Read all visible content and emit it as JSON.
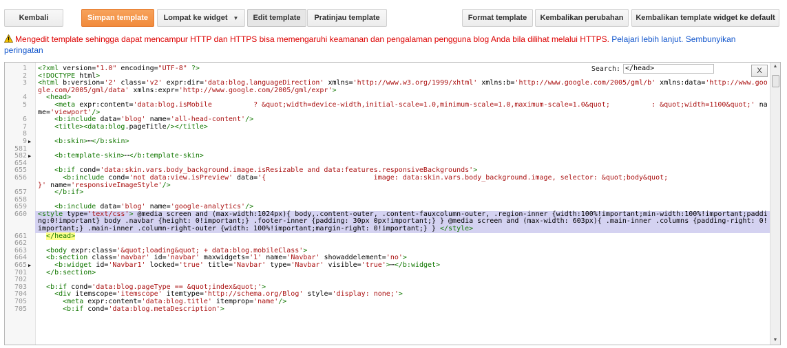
{
  "toolbar": {
    "back": "Kembali",
    "save": "Simpan template",
    "jump": "Lompat ke widget",
    "edit": "Edit template",
    "preview": "Pratinjau template",
    "format": "Format template",
    "revert": "Kembalikan perubahan",
    "revert_widgets": "Kembalikan template widget ke default"
  },
  "warning": {
    "text": "Mengedit template sehingga dapat mencampur HTTP dan HTTPS bisa memengaruhi keamanan dan pengalaman pengguna blog Anda bila dilihat melalui HTTPS. ",
    "learn_more": "Pelajari lebih lanjut.",
    "hide": "Sembunyikan peringatan"
  },
  "search": {
    "label": "Search:",
    "value": "</head>",
    "close": "X"
  },
  "colors": {
    "accent": "#f18b3c",
    "highlight": "#d4d2f1",
    "warning": "#dd0000",
    "link": "#1155cc"
  },
  "code_lines": [
    {
      "n": "1",
      "t": "<?xml version=\"1.0\" encoding=\"UTF-8\" ?>"
    },
    {
      "n": "2",
      "t": "<!DOCTYPE html>"
    },
    {
      "n": "3",
      "t": "<html b:version='2' class='v2' expr:dir='data:blog.languageDirection' xmlns='http://www.w3.org/1999/xhtml' xmlns:b='http://www.google.com/2005/gml/b' xmlns:data='http://www.google.com/2005/gml/data' xmlns:expr='http://www.google.com/2005/gml/expr'>"
    },
    {
      "n": "4",
      "t": "  <head>"
    },
    {
      "n": "5",
      "t": "    <meta expr:content='data:blog.isMobile          ? &quot;width=device-width,initial-scale=1.0,minimum-scale=1.0,maximum-scale=1.0&quot;          : &quot;width=1100&quot;' name='viewport'/>"
    },
    {
      "n": "6",
      "t": "    <b:include data='blog' name='all-head-content'/>"
    },
    {
      "n": "7",
      "t": "    <title><data:blog.pageTitle/></title>"
    },
    {
      "n": "8",
      "t": ""
    },
    {
      "n": "9",
      "f": "▶",
      "t": "    <b:skin>⋯</b:skin>"
    },
    {
      "n": "581",
      "t": ""
    },
    {
      "n": "582",
      "f": "▶",
      "t": "    <b:template-skin>⋯</b:template-skin>"
    },
    {
      "n": "654",
      "t": ""
    },
    {
      "n": "655",
      "t": "    <b:if cond='data:skin.vars.body_background.image.isResizable and data:features.responsiveBackgrounds'>"
    },
    {
      "n": "656",
      "t": "      <b:include cond='not data:view.isPreview' data='{                          image: data:skin.vars.body_background.image, selector: &quot;body&quot;                          }' name='responsiveImageStyle'/>"
    },
    {
      "n": "657",
      "t": "    </b:if>"
    },
    {
      "n": "658",
      "t": ""
    },
    {
      "n": "659",
      "t": "    <b:include data='blog' name='google-analytics'/>"
    },
    {
      "n": "660",
      "hl": true,
      "t": "<style type='text/css'> @media screen and (max-width:1024px){ body,.content-outer, .content-fauxcolumn-outer, .region-inner {width:100%!important;min-width:100%!important;padding:0!important} body .navbar {height: 0!important;} .footer-inner {padding: 30px 0px!important;} } @media screen and (max-width: 603px){ .main-inner .columns {padding-right: 0!important;} .main-inner .column-right-outer {width: 100%!important;margin-right: 0!important;} } </style>"
    },
    {
      "n": "661",
      "hl2": true,
      "t": "  </head>"
    },
    {
      "n": "662",
      "t": ""
    },
    {
      "n": "663",
      "t": "  <body expr:class='&quot;loading&quot; + data:blog.mobileClass'>"
    },
    {
      "n": "664",
      "t": "  <b:section class='navbar' id='navbar' maxwidgets='1' name='Navbar' showaddelement='no'>"
    },
    {
      "n": "665",
      "f": "▶",
      "t": "    <b:widget id='Navbar1' locked='true' title='Navbar' type='Navbar' visible='true'>⋯</b:widget>"
    },
    {
      "n": "701",
      "t": "  </b:section>"
    },
    {
      "n": "702",
      "t": ""
    },
    {
      "n": "703",
      "t": "  <b:if cond='data:blog.pageType == &quot;index&quot;'>"
    },
    {
      "n": "704",
      "t": "    <div itemscope='itemscope' itemtype='http://schema.org/Blog' style='display: none;'>"
    },
    {
      "n": "705",
      "t": "      <meta expr:content='data:blog.title' itemprop='name'/>"
    },
    {
      "n": "705",
      "t": "      <b:if cond='data:blog.metaDescription'>"
    }
  ]
}
